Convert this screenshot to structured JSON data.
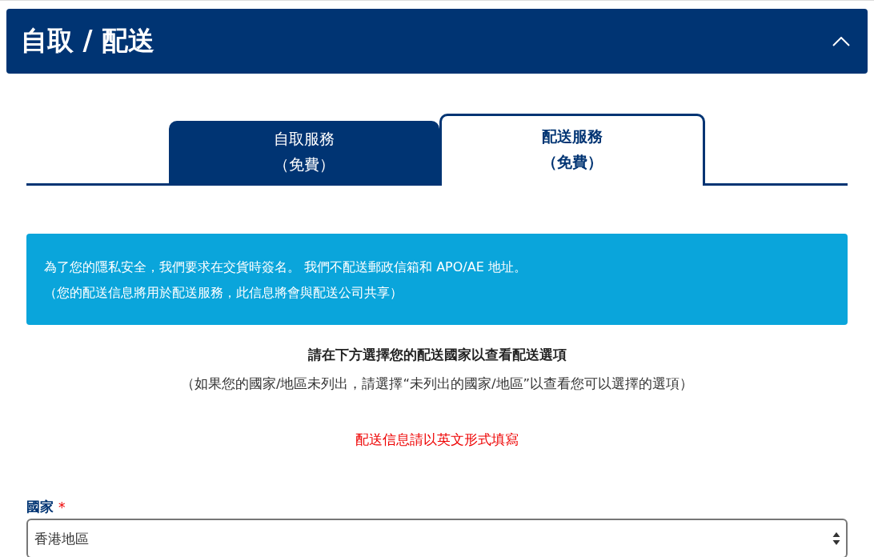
{
  "section": {
    "title": "自取 / 配送",
    "expanded": true
  },
  "tabs": [
    {
      "lines": [
        "自取服務",
        "（免費）"
      ],
      "selected": false
    },
    {
      "lines": [
        "配送服務",
        "（免費）"
      ],
      "selected": true
    }
  ],
  "notice": {
    "lines": [
      "為了您的隱私安全，我們要求在交貨時簽名。 我們不配送郵政信箱和 APO/AE 地址。",
      "（您的配送信息將用於配送服務，此信息將會與配送公司共享）"
    ]
  },
  "instructions": [
    {
      "kind": "heading",
      "text": "請在下方選擇您的配送國家以查看配送選項"
    },
    {
      "kind": "note",
      "text": "（如果您的國家/地區未列出，請選擇“未列出的國家/地區”以查看您可以選擇的選項）"
    },
    {
      "kind": "warning",
      "text": "配送信息請以英文形式填寫"
    }
  ],
  "country_field": {
    "label": "國家",
    "required_mark": "*",
    "value": "香港地區"
  }
}
